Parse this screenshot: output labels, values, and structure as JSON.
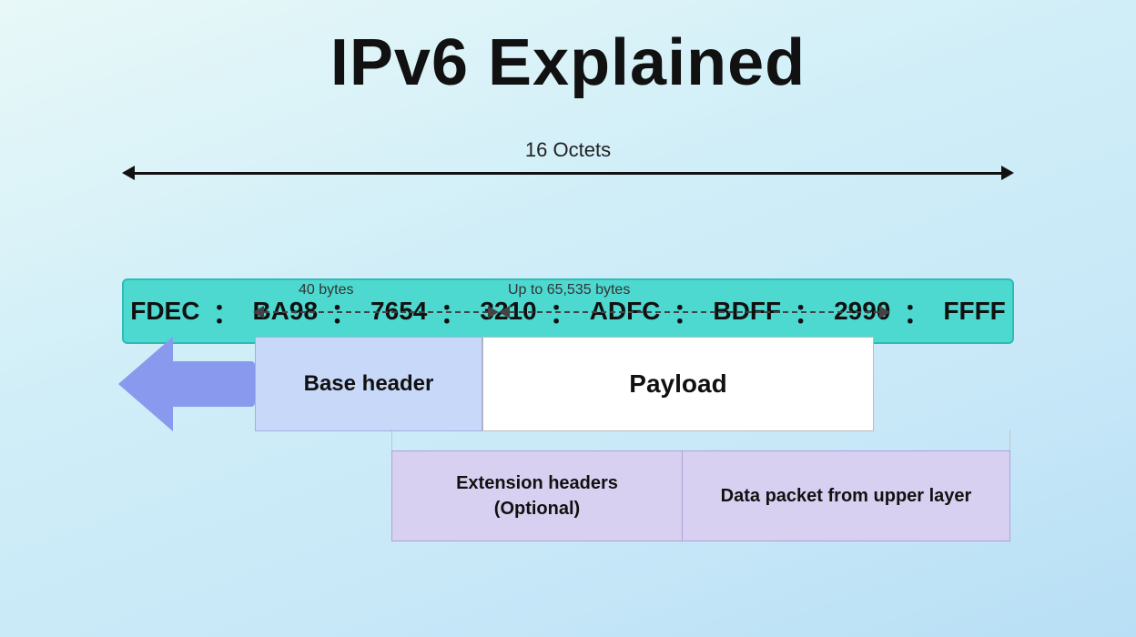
{
  "title": "IPv6 Explained",
  "octets_label": "16 Octets",
  "ipv6_address": {
    "segments": [
      "FDEC",
      "BA98",
      "7654",
      "3210",
      "ADFC",
      "BDFF",
      "2990",
      "FFFF"
    ],
    "separator": "："
  },
  "arrows": {
    "label_40": "40 bytes",
    "label_65535": "Up to 65,535 bytes"
  },
  "packet": {
    "base_header_label": "Base header",
    "payload_label": "Payload"
  },
  "bottom_boxes": {
    "extension_label": "Extension headers\n(Optional)",
    "data_packet_label": "Data packet from upper layer"
  }
}
